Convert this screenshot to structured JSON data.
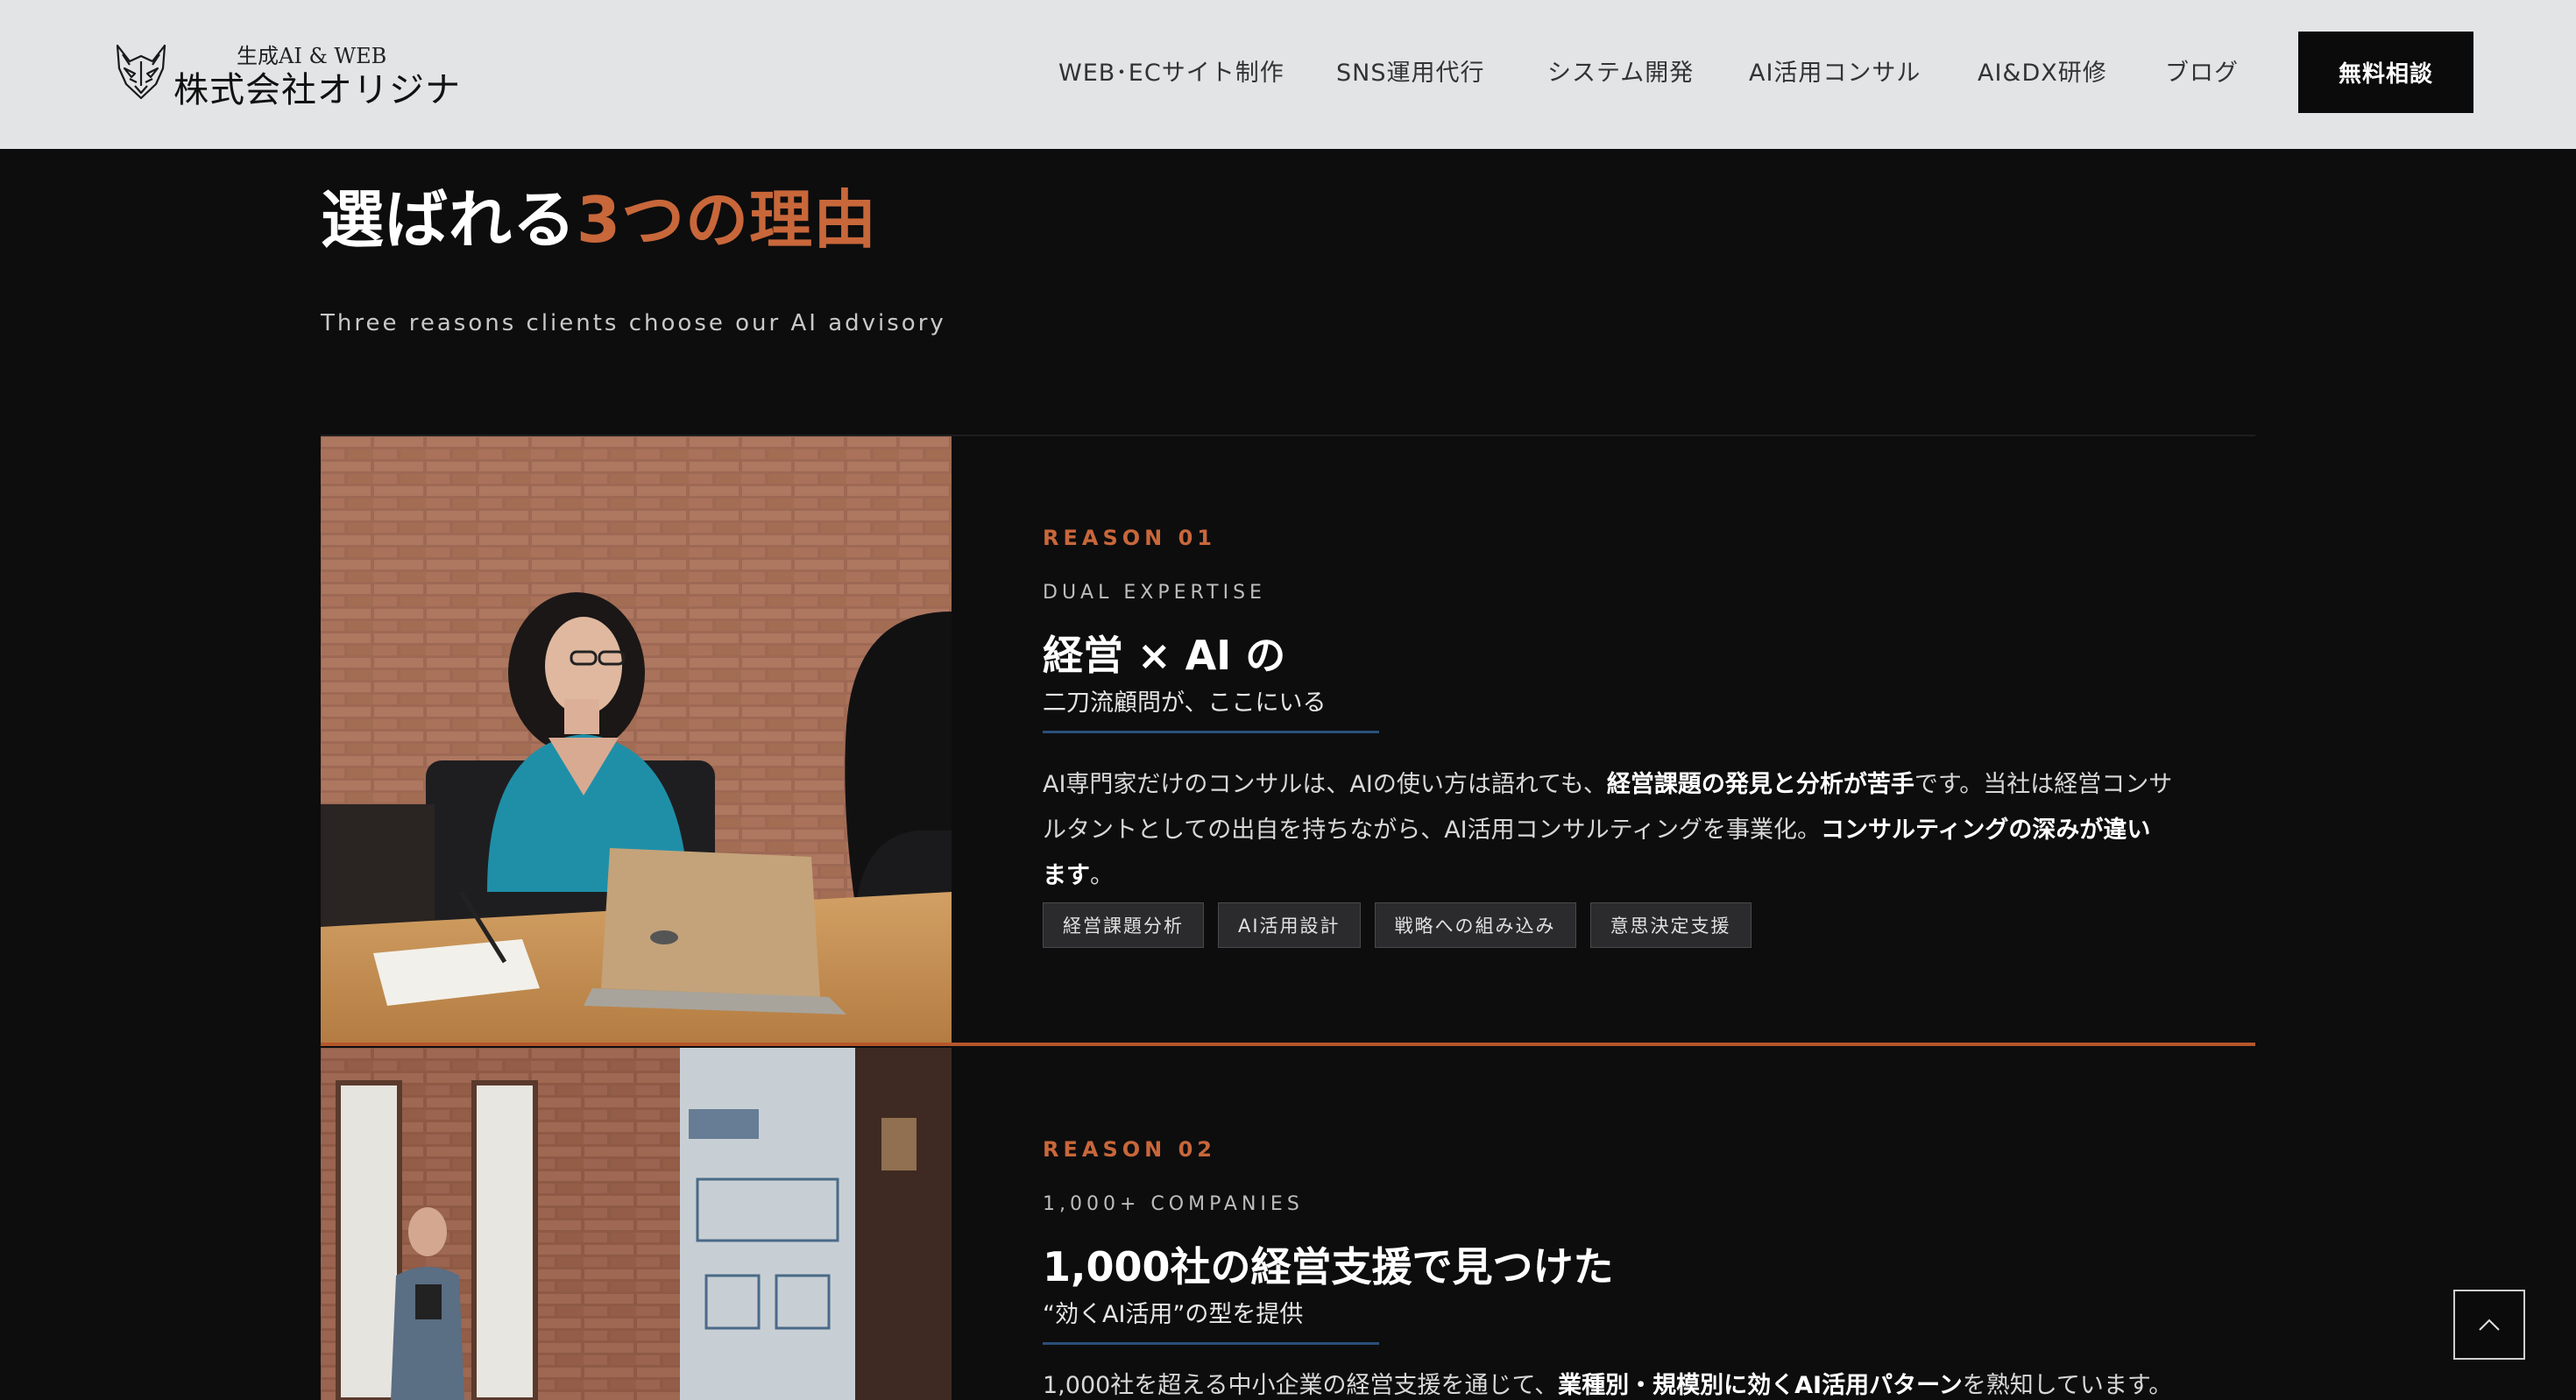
{
  "header": {
    "logo_sub": "生成AI & WEB",
    "logo_main": "株式会社オリジナ",
    "logo_icon": "fox-icon",
    "nav": [
      {
        "label": "WEB･ECサイト制作"
      },
      {
        "label": "SNS運用代行"
      },
      {
        "label": "システム開発"
      },
      {
        "label": "AI活用コンサル"
      },
      {
        "label": "AI&DX研修"
      },
      {
        "label": "ブログ"
      }
    ],
    "cta_label": "無料相談"
  },
  "section": {
    "title_main": "選ばれる",
    "title_accent": "3つの理由",
    "subtitle": "Three reasons clients choose our AI advisory"
  },
  "reasons": [
    {
      "label": "REASON 01",
      "eyebrow": "DUAL EXPERTISE",
      "title": "経営 × AI の",
      "subtitle": "二刀流顧問が、ここにいる",
      "desc_1": "AI専門家だけのコンサルは、AIの使い方は語れても、",
      "desc_1_bold": "経営課題の発見と分析が苦手",
      "desc_2": "です。当社は経営コンサルタントとしての出自を持ちながら、AI活用コンサルティングを事業化。",
      "desc_2_bold": "コンサルティングの深みが違います",
      "desc_3": "。",
      "tags": [
        "経営課題分析",
        "AI活用設計",
        "戦略への組み込み",
        "意思決定支援"
      ],
      "image_alt": "meeting-photo"
    },
    {
      "label": "REASON 02",
      "eyebrow": "1,000+ COMPANIES",
      "title": "1,000社の経営支援で見つけた",
      "subtitle": "“効くAI活用”の型を提供",
      "desc_1": "1,000社を超える中小企業の経営支援を通じて、",
      "desc_1_bold": "業種別・規模別に効くAI活用パターン",
      "desc_2": "を熟知しています。「とりあ",
      "image_alt": "presentation-photo"
    }
  ],
  "colors": {
    "accent": "#c8673a",
    "background": "#0d0d0e",
    "header_bg": "#e3e4e6",
    "underline": "#2a4f7a"
  },
  "back_to_top_icon": "chevron-up-icon"
}
